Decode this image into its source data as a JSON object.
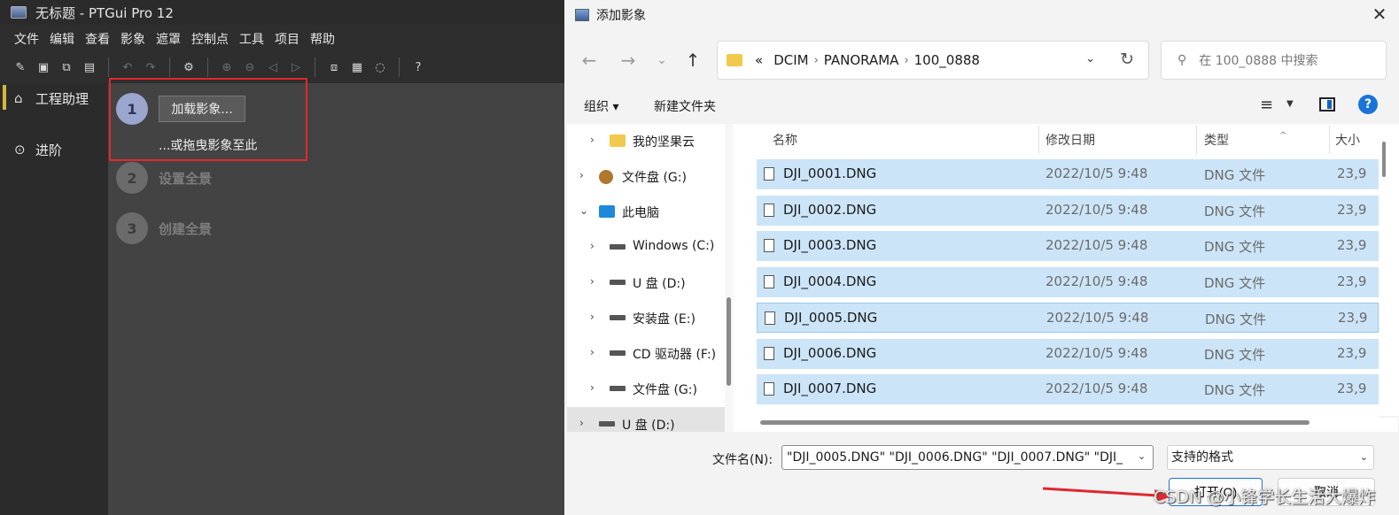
{
  "ptgui": {
    "title": "无标题 - PTGui Pro 12",
    "menu": [
      "文件",
      "编辑",
      "查看",
      "影象",
      "遮罩",
      "控制点",
      "工具",
      "项目",
      "帮助"
    ],
    "sidebar": [
      {
        "label": "工程助理",
        "icon": "home-icon"
      },
      {
        "label": "进阶",
        "icon": "chevron-circle-icon"
      }
    ],
    "steps": [
      {
        "num": "1",
        "label": ""
      },
      {
        "num": "2",
        "label": "设置全景"
      },
      {
        "num": "3",
        "label": "创建全景"
      }
    ],
    "load_button": "加载影象...",
    "drag_text": "...或拖曳影象至此"
  },
  "dialog": {
    "title": "添加影象",
    "address": {
      "prefix": "«",
      "segments": [
        "DCIM",
        "PANORAMA",
        "100_0888"
      ]
    },
    "search_placeholder": "在 100_0888 中搜索",
    "organize": "组织 ▾",
    "new_folder": "新建文件夹",
    "help": "?",
    "tree": [
      {
        "label": "我的坚果云",
        "icon": "folder-icon",
        "expand": "›",
        "indent": 1,
        "selected": false
      },
      {
        "label": "文件盘 (G:)",
        "icon": "nut-icon",
        "expand": "›",
        "indent": 0,
        "selected": false
      },
      {
        "label": "此电脑",
        "icon": "pc-icon",
        "expand": "⌄",
        "indent": 0,
        "selected": false
      },
      {
        "label": "Windows (C:)",
        "icon": "drive-icon",
        "expand": "›",
        "indent": 1,
        "selected": false
      },
      {
        "label": "U 盘 (D:)",
        "icon": "drive-icon",
        "expand": "›",
        "indent": 1,
        "selected": false
      },
      {
        "label": "安装盘 (E:)",
        "icon": "drive-icon",
        "expand": "›",
        "indent": 1,
        "selected": false
      },
      {
        "label": "CD 驱动器 (F:)",
        "icon": "drive-icon",
        "expand": "›",
        "indent": 1,
        "selected": false
      },
      {
        "label": "文件盘 (G:)",
        "icon": "drive-icon",
        "expand": "›",
        "indent": 1,
        "selected": false
      },
      {
        "label": "U 盘 (D:)",
        "icon": "drive-icon",
        "expand": "›",
        "indent": 0,
        "selected": true
      }
    ],
    "columns": [
      "名称",
      "修改日期",
      "类型",
      "大小"
    ],
    "files": [
      {
        "name": "DJI_0001.DNG",
        "date": "2022/10/5 9:48",
        "type": "DNG 文件",
        "size": "23,9",
        "focus": false
      },
      {
        "name": "DJI_0002.DNG",
        "date": "2022/10/5 9:48",
        "type": "DNG 文件",
        "size": "23,9",
        "focus": false
      },
      {
        "name": "DJI_0003.DNG",
        "date": "2022/10/5 9:48",
        "type": "DNG 文件",
        "size": "23,9",
        "focus": false
      },
      {
        "name": "DJI_0004.DNG",
        "date": "2022/10/5 9:48",
        "type": "DNG 文件",
        "size": "23,9",
        "focus": false
      },
      {
        "name": "DJI_0005.DNG",
        "date": "2022/10/5 9:48",
        "type": "DNG 文件",
        "size": "23,9",
        "focus": true
      },
      {
        "name": "DJI_0006.DNG",
        "date": "2022/10/5 9:48",
        "type": "DNG 文件",
        "size": "23,9",
        "focus": false
      },
      {
        "name": "DJI_0007.DNG",
        "date": "2022/10/5 9:48",
        "type": "DNG 文件",
        "size": "23,9",
        "focus": false
      }
    ],
    "filename_label": "文件名(N):",
    "filename_value": "\"DJI_0005.DNG\" \"DJI_0006.DNG\" \"DJI_0007.DNG\" \"DJI_",
    "filter_value": "支持的格式",
    "open_button": "打开(O)",
    "cancel_button": "取消"
  },
  "watermark": "CSDN @小锋学长生活大爆炸",
  "colors": {
    "highlight": "#e0282e",
    "selection": "#cce4f7",
    "accent": "#1a73d9"
  }
}
